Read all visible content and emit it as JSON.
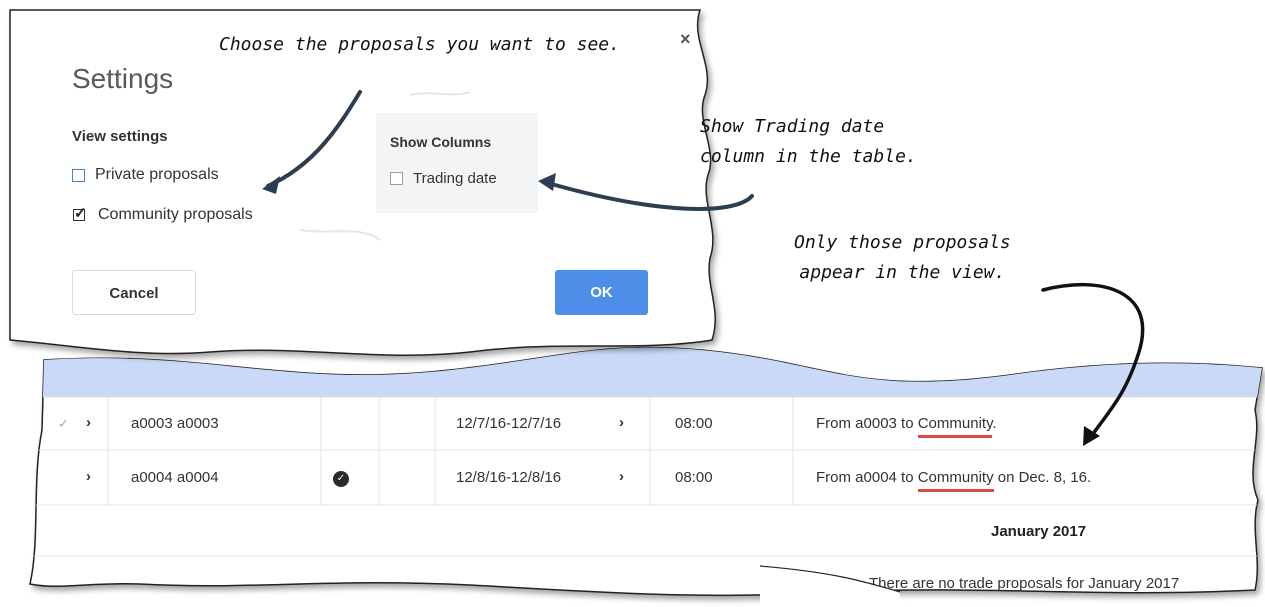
{
  "dialog": {
    "title": "Settings",
    "close_label": "×",
    "view_settings": {
      "heading": "View settings",
      "options": [
        {
          "label": "Private proposals",
          "checked": false
        },
        {
          "label": "Community proposals",
          "checked": true
        }
      ]
    },
    "show_columns": {
      "heading": "Show Columns",
      "options": [
        {
          "label": "Trading date",
          "checked": false
        }
      ]
    },
    "cancel_label": "Cancel",
    "ok_label": "OK"
  },
  "annotations": {
    "choose": "Choose the proposals you want to see.",
    "show_trading_line1": "Show Trading date",
    "show_trading_line2": "column in the table.",
    "only_those_line1": "Only those proposals",
    "only_those_line2": "appear in the view."
  },
  "table": {
    "rows": [
      {
        "check": "✓",
        "expand": "›",
        "name": "a0003 a0003",
        "has_badge": false,
        "dates": "12/7/16-12/7/16",
        "dates_chevron": "›",
        "time": "08:00",
        "desc_prefix": "From a0003 to ",
        "desc_highlight": "Community",
        "desc_suffix": "."
      },
      {
        "check": "",
        "expand": "›",
        "name": "a0004 a0004",
        "has_badge": true,
        "dates": "12/8/16-12/8/16",
        "dates_chevron": "›",
        "time": "08:00",
        "desc_prefix": "From a0004 to ",
        "desc_highlight": "Community",
        "desc_suffix": " on Dec. 8, 16."
      }
    ],
    "month_header": "January 2017",
    "empty_message": "There are no trade proposals for January 2017"
  },
  "colors": {
    "header_band": "#c9d9f7",
    "ok_button": "#4c8ee8",
    "underline": "#e04848",
    "checkbox_border": "#4a7fd0"
  }
}
